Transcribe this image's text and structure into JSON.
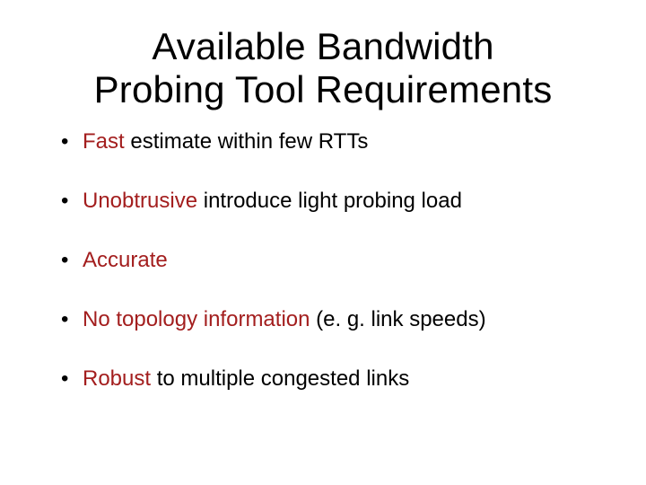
{
  "title_line1": "Available Bandwidth",
  "title_line2": "Probing Tool Requirements",
  "bullets": [
    {
      "highlight": "Fast",
      "rest": " estimate within few RTTs"
    },
    {
      "highlight": "Unobtrusive",
      "rest": " introduce light probing load"
    },
    {
      "highlight": "Accurate",
      "rest": ""
    },
    {
      "highlight": "No topology information",
      "rest": " (e. g. link speeds)"
    },
    {
      "highlight": "Robust",
      "rest": " to multiple congested links"
    }
  ]
}
